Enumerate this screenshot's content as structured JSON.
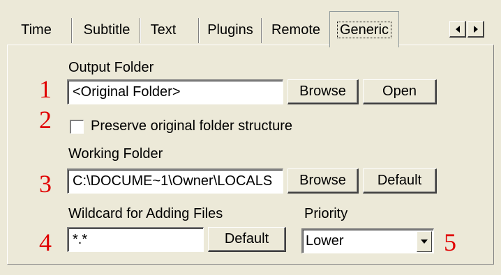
{
  "tabs": [
    {
      "label": "Time"
    },
    {
      "label": "Subtitle"
    },
    {
      "label": "Text"
    },
    {
      "label": "Plugins"
    },
    {
      "label": "Remote"
    },
    {
      "label": "Generic",
      "active": true
    }
  ],
  "tab_scroll": {
    "left_icon": "triangle-left-icon",
    "right_icon": "triangle-right-icon"
  },
  "output_folder": {
    "label": "Output Folder",
    "value": "<Original Folder>",
    "browse_label": "Browse",
    "open_label": "Open",
    "marker": "1"
  },
  "preserve": {
    "label": "Preserve original folder structure",
    "checked": false,
    "marker": "2"
  },
  "working_folder": {
    "label": "Working Folder",
    "value": "C:\\DOCUME~1\\Owner\\LOCALS",
    "browse_label": "Browse",
    "default_label": "Default",
    "marker": "3"
  },
  "wildcard": {
    "label": "Wildcard for Adding Files",
    "value": "*.*",
    "default_label": "Default",
    "marker": "4"
  },
  "priority": {
    "label": "Priority",
    "selected": "Lower",
    "marker": "5"
  },
  "colors": {
    "marker": "#e00000",
    "background": "#ece9d8"
  }
}
